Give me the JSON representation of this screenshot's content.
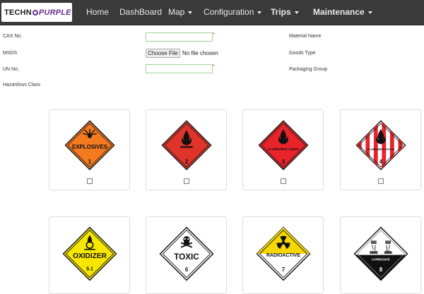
{
  "brand": {
    "part1": "TECHN",
    "part2": "PURPLE"
  },
  "nav": {
    "home": "Home",
    "dashboard": "DashBoard",
    "map": "Map",
    "configuration": "Configuration",
    "trips": "Trips",
    "maintenance": "Maintenance"
  },
  "form": {
    "cas_label": "CAS No.",
    "msds_label": "MSDS",
    "un_label": "UN No.",
    "hazard_label": "Hazardous Class",
    "material_label": "Material Name",
    "goods_label": "Goods Type",
    "packaging_label": "Packaging Group",
    "required_mark": "*",
    "file_button": "Choose File",
    "file_status": "No file chosen",
    "cas_value": "",
    "un_value": ""
  },
  "hazard_classes": [
    {
      "label": "EXPLOSIVES",
      "number": "1",
      "color": "#f47a20"
    },
    {
      "label": "",
      "number": "2",
      "color": "#e0342b"
    },
    {
      "label": "FLAMMABLE LIQUID",
      "number": "3",
      "color": "#e8232a"
    },
    {
      "label": "FLAMMABLE SOLID",
      "number": "4",
      "color": "#e8232a"
    },
    {
      "label": "OXIDIZER",
      "number": "5.1",
      "color": "#f6e600"
    },
    {
      "label": "TOXIC",
      "number": "6",
      "color": "#ffffff"
    },
    {
      "label": "RADIOACTIVE",
      "number": "7",
      "color": "#f7d800"
    },
    {
      "label": "CORROSIVE",
      "number": "8",
      "color": "#ffffff"
    }
  ]
}
